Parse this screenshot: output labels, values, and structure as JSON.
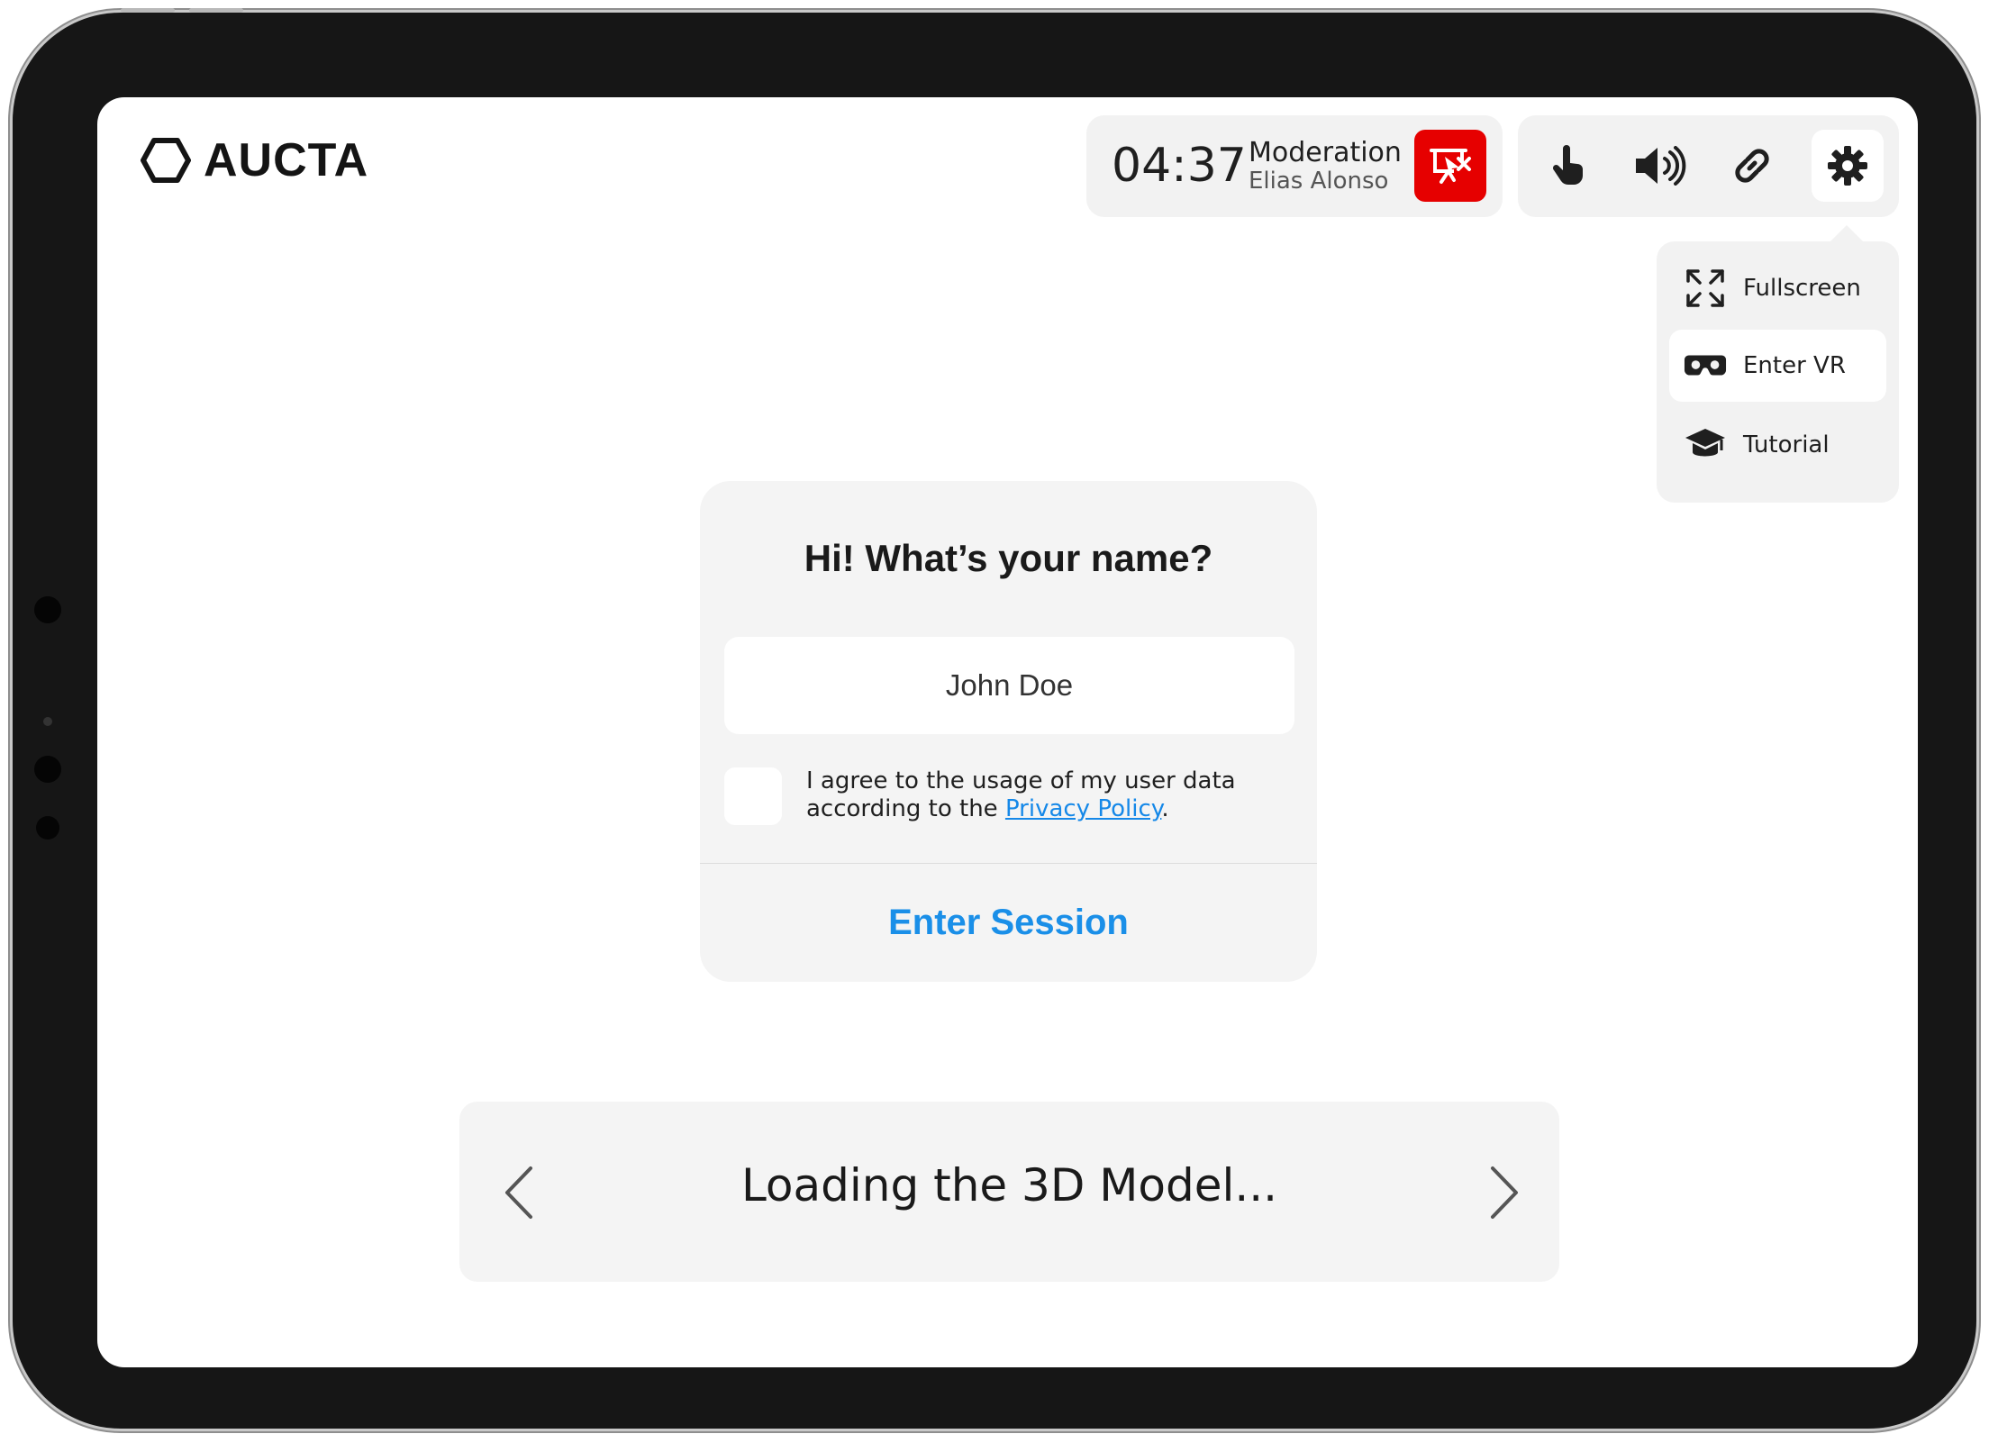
{
  "header": {
    "logo_text": "AUCTA",
    "moderation": {
      "timer": "04:37",
      "title": "Moderation",
      "moderator": "Elias Alonso",
      "stop_icon": "stop-presentation-icon",
      "stop_color": "#e60000"
    },
    "tools": [
      {
        "icon": "hand-pointer-icon"
      },
      {
        "icon": "volume-icon"
      },
      {
        "icon": "link-icon"
      },
      {
        "icon": "gear-icon",
        "active": true
      }
    ]
  },
  "settings_menu": {
    "items": [
      {
        "label": "Fullscreen",
        "icon": "fullscreen-icon"
      },
      {
        "label": "Enter VR",
        "icon": "vr-headset-icon",
        "highlighted": true
      },
      {
        "label": "Tutorial",
        "icon": "graduation-cap-icon"
      }
    ]
  },
  "dialog": {
    "title": "Hi! What’s your name?",
    "name_value": "John Doe",
    "consent_text_1": "I agree to the usage of my user data",
    "consent_text_2": "according to the ",
    "privacy_link": "Privacy Policy",
    "consent_text_end": ".",
    "consent_checked": false,
    "enter_button": "Enter Session",
    "accent_color": "#1a8fe8"
  },
  "loading": {
    "text": "Loading the 3D Model...",
    "prev_icon": "chevron-left-icon",
    "next_icon": "chevron-right-icon"
  }
}
